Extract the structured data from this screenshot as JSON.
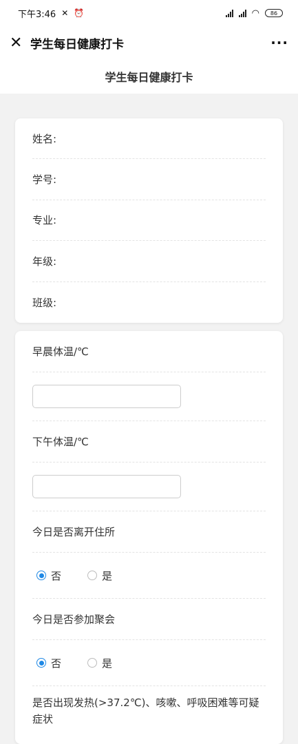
{
  "status_bar": {
    "time": "下午3:46",
    "battery": "86"
  },
  "nav": {
    "title": "学生每日健康打卡",
    "more": "···"
  },
  "page_header": "学生每日健康打卡",
  "info_fields": [
    {
      "label": "姓名:"
    },
    {
      "label": "学号:"
    },
    {
      "label": "专业:"
    },
    {
      "label": "年级:"
    },
    {
      "label": "班级:"
    }
  ],
  "form": {
    "morning_temp_label": "早晨体温/℃",
    "morning_temp_value": "",
    "afternoon_temp_label": "下午体温/℃",
    "afternoon_temp_value": "",
    "left_residence_label": "今日是否离开住所",
    "left_residence_options": [
      "否",
      "是"
    ],
    "left_residence_selected": "否",
    "gathering_label": "今日是否参加聚会",
    "gathering_options": [
      "否",
      "是"
    ],
    "gathering_selected": "否",
    "symptoms_label": "是否出现发热(>37.2℃)、咳嗽、呼吸困难等可疑症状"
  },
  "colors": {
    "accent": "#1e88e5",
    "background": "#f2f2f2"
  }
}
